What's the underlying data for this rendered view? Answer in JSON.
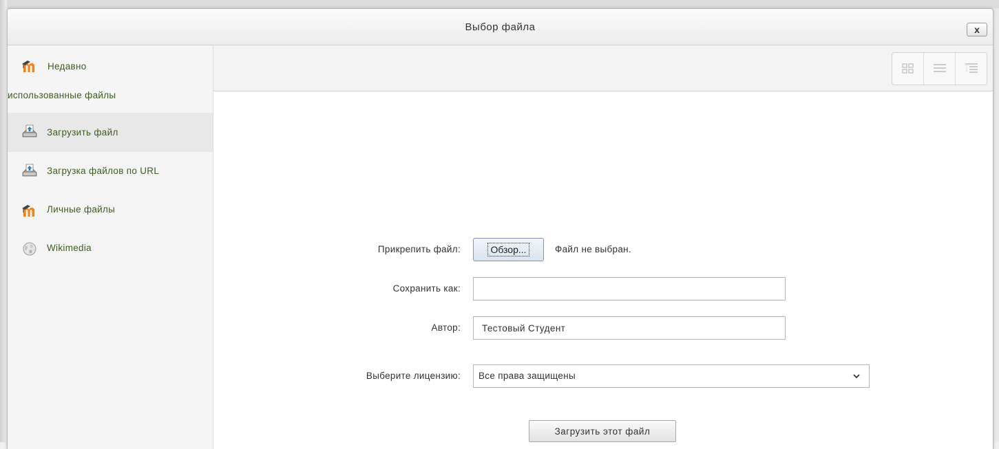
{
  "dialog": {
    "title": "Выбор файла",
    "close_label": "x"
  },
  "sidebar": {
    "items": [
      {
        "label_line1": "Недавно",
        "label_line2": "использованные файлы",
        "icon": "moodle-icon"
      },
      {
        "label": "Загрузить файл",
        "icon": "upload-icon",
        "active": true
      },
      {
        "label": "Загрузка файлов по URL",
        "icon": "upload-url-icon"
      },
      {
        "label": "Личные файлы",
        "icon": "moodle-icon"
      },
      {
        "label": "Wikimedia",
        "icon": "wikimedia-globe-icon"
      }
    ]
  },
  "toolbar": {
    "views": [
      "grid-view-icon",
      "list-view-icon",
      "tree-view-icon"
    ]
  },
  "form": {
    "attach_label": "Прикрепить файл:",
    "browse_label": "Обзор...",
    "no_file_text": "Файл не выбран.",
    "save_as_label": "Сохранить как:",
    "save_as_value": "",
    "author_label": "Автор:",
    "author_value": "Тестовый Студент",
    "license_label": "Выберите лицензию:",
    "license_value": "Все права защищены",
    "upload_button": "Загрузить этот файл"
  },
  "colors": {
    "link_green": "#3d5d22",
    "moodle_orange": "#f98012",
    "active_bg": "#e8e8e8"
  }
}
